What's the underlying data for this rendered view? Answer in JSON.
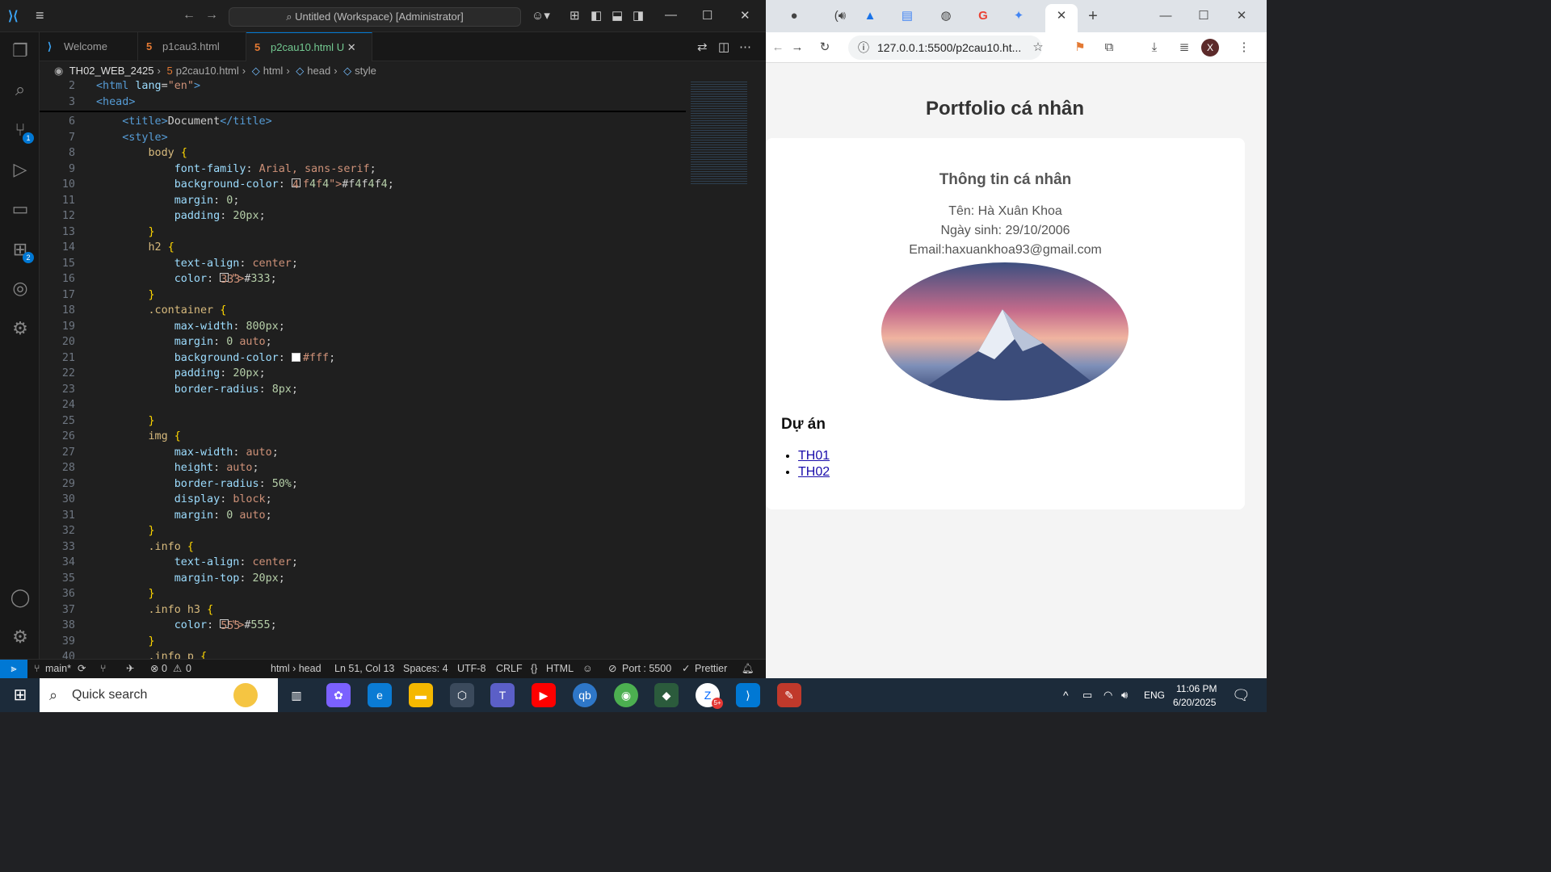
{
  "vscode": {
    "command_center": "Untitled (Workspace) [Administrator]",
    "tabs": [
      {
        "label": "Welcome"
      },
      {
        "label": "p1cau3.html"
      },
      {
        "label": "p2cau10.html",
        "status": "U"
      }
    ],
    "breadcrumb": [
      "TH02_WEB_2425",
      "p2cau10.html",
      "html",
      "head",
      "style"
    ],
    "activity_badges": {
      "scm": "1",
      "extensions": "2"
    },
    "status": {
      "branch": "main*",
      "problems": "0",
      "warnings": "0",
      "scope": "html › head",
      "cursor": "Ln 51, Col 13",
      "spaces": "Spaces: 4",
      "encoding": "UTF-8",
      "eol": "CRLF",
      "language": "HTML",
      "port": "Port : 5500",
      "formatter": "Prettier"
    },
    "code_lines": [
      {
        "n": "2",
        "t": "<html lang=\"en\">"
      },
      {
        "n": "3",
        "t": "<head>"
      },
      {
        "n": "6",
        "t": "    <title>Document</title>"
      },
      {
        "n": "7",
        "t": "    <style>"
      },
      {
        "n": "8",
        "t": "        body {"
      },
      {
        "n": "9",
        "t": "            font-family: Arial, sans-serif;"
      },
      {
        "n": "10",
        "t": "            background-color: #f4f4f4;"
      },
      {
        "n": "11",
        "t": "            margin: 0;"
      },
      {
        "n": "12",
        "t": "            padding: 20px;"
      },
      {
        "n": "13",
        "t": "        }"
      },
      {
        "n": "14",
        "t": "        h2 {"
      },
      {
        "n": "15",
        "t": "            text-align: center;"
      },
      {
        "n": "16",
        "t": "            color: #333;"
      },
      {
        "n": "17",
        "t": "        }"
      },
      {
        "n": "18",
        "t": "        .container {"
      },
      {
        "n": "19",
        "t": "            max-width: 800px;"
      },
      {
        "n": "20",
        "t": "            margin: 0 auto;"
      },
      {
        "n": "21",
        "t": "            background-color: #fff;"
      },
      {
        "n": "22",
        "t": "            padding: 20px;"
      },
      {
        "n": "23",
        "t": "            border-radius: 8px;"
      },
      {
        "n": "24",
        "t": ""
      },
      {
        "n": "25",
        "t": "        }"
      },
      {
        "n": "26",
        "t": "        img {"
      },
      {
        "n": "27",
        "t": "            max-width: auto;"
      },
      {
        "n": "28",
        "t": "            height: auto;"
      },
      {
        "n": "29",
        "t": "            border-radius: 50%;"
      },
      {
        "n": "30",
        "t": "            display: block;"
      },
      {
        "n": "31",
        "t": "            margin: 0 auto;"
      },
      {
        "n": "32",
        "t": "        }"
      },
      {
        "n": "33",
        "t": "        .info {"
      },
      {
        "n": "34",
        "t": "            text-align: center;"
      },
      {
        "n": "35",
        "t": "            margin-top: 20px;"
      },
      {
        "n": "36",
        "t": "        }"
      },
      {
        "n": "37",
        "t": "        .info h3 {"
      },
      {
        "n": "38",
        "t": "            color: #555;"
      },
      {
        "n": "39",
        "t": "        }"
      },
      {
        "n": "40",
        "t": "        .info p {"
      }
    ]
  },
  "browser": {
    "address": "127.0.0.1:5500/p2cau10.ht...",
    "profile_initial": "X",
    "page": {
      "heading": "Portfolio cá nhân",
      "info_title": "Thông tin cá nhân",
      "name": "Tên: Hà Xuân Khoa",
      "dob": "Ngày sinh: 29/10/2006",
      "email": "Email:haxuankhoa93@gmail.com",
      "projects_title": "Dự án",
      "projects": [
        "TH01",
        "TH02"
      ]
    }
  },
  "taskbar": {
    "search": "Quick search",
    "lang": "ENG",
    "time": "11:06 PM",
    "date": "6/20/2025",
    "zalo_badge": "5+"
  }
}
